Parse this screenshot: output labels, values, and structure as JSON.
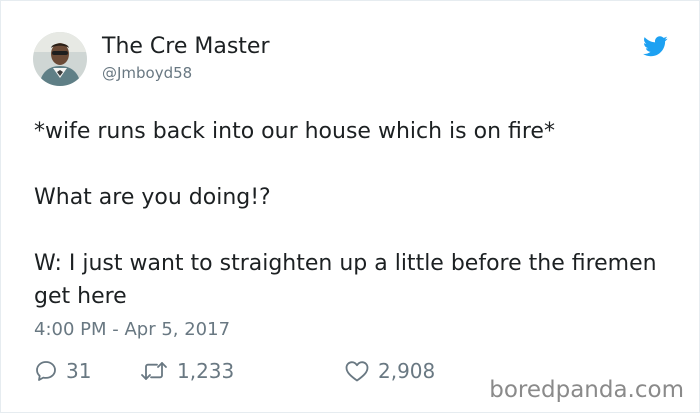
{
  "author": {
    "display_name": "The Cre Master",
    "handle": "@Jmboyd58"
  },
  "tweet": {
    "lines": [
      "*wife runs back into our house which is on fire*",
      "What are you doing!?",
      "W: I just want to straighten up a little before the firemen get here"
    ],
    "timestamp": "4:00 PM - Apr 5, 2017"
  },
  "actions": {
    "replies": "31",
    "retweets": "1,233",
    "likes": "2,908"
  },
  "icons": {
    "brand": "twitter-bird-icon",
    "reply": "speech-bubble-icon",
    "retweet": "retweet-arrows-icon",
    "like": "heart-icon"
  },
  "colors": {
    "twitter_blue": "#1da1f2",
    "secondary_text": "#697882",
    "primary_text": "#1c2022"
  },
  "watermark": "boredpanda.com"
}
